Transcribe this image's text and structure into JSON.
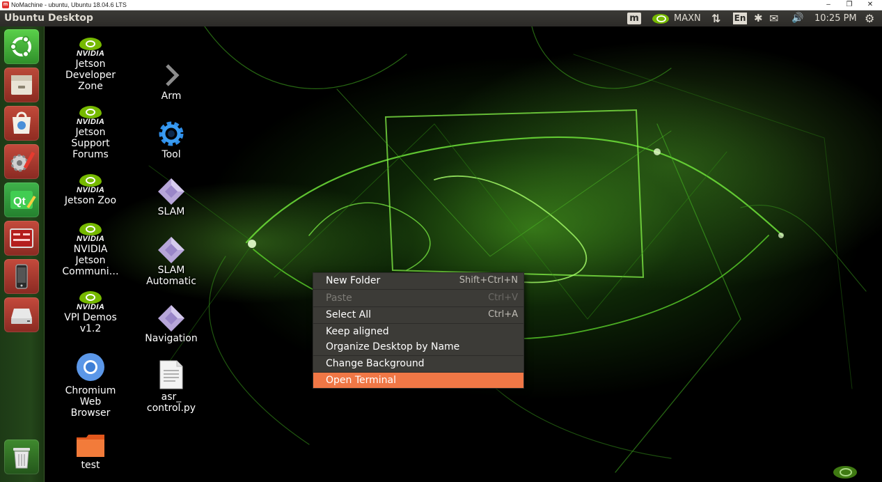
{
  "window": {
    "title": "NoMachine - ubuntu, Ubuntu 18.04.6 LTS",
    "logo": "m",
    "minimize": "–",
    "restore": "❐",
    "close": "✕"
  },
  "topbar": {
    "title": "Ubuntu Desktop",
    "nomachine_icon": "m",
    "power_mode": "MAXN",
    "keyboard_layout": "En",
    "network_glyph": "⇅",
    "bluetooth_glyph": "✱",
    "mail_glyph": "✉",
    "volume_glyph": "🔊",
    "clock": "10:25 PM",
    "settings_glyph": "⚙"
  },
  "launcher": {
    "items": [
      "ubuntu-home",
      "files",
      "software-center",
      "system-settings",
      "qt-creator",
      "terminal-app",
      "phone",
      "drive",
      "trash"
    ]
  },
  "desktop": {
    "nvidia_word": "NVIDIA",
    "icons": [
      {
        "label": "Jetson\nDeveloper\nZone",
        "icon": "nvidia-icon"
      },
      {
        "label": "Jetson\nSupport\nForums",
        "icon": "nvidia-icon"
      },
      {
        "label": "Jetson Zoo",
        "icon": "nvidia-icon"
      },
      {
        "label": "NVIDIA\nJetson\nCommuni…",
        "icon": "nvidia-icon"
      },
      {
        "label": "VPI Demos\nv1.2",
        "icon": "nvidia-icon"
      },
      {
        "label": "Chromium\nWeb\nBrowser",
        "icon": "chromium-icon"
      },
      {
        "label": "test",
        "icon": "folder-icon"
      },
      {
        "label": "Arm",
        "icon": "chevron-right-icon"
      },
      {
        "label": "Tool",
        "icon": "gear-icon"
      },
      {
        "label": "SLAM",
        "icon": "launcher-icon"
      },
      {
        "label": "SLAM\nAutomatic",
        "icon": "launcher-icon"
      },
      {
        "label": "Navigation",
        "icon": "launcher-icon"
      },
      {
        "label": "asr_\ncontrol.py",
        "icon": "text-file-icon"
      }
    ]
  },
  "context_menu": {
    "items": [
      {
        "label": "New Folder",
        "shortcut": "Shift+Ctrl+N",
        "state": "normal"
      },
      {
        "label": "Paste",
        "shortcut": "Ctrl+V",
        "state": "disabled"
      },
      {
        "label": "Select All",
        "shortcut": "Ctrl+A",
        "state": "normal"
      },
      {
        "label": "Keep aligned",
        "shortcut": "",
        "state": "normal"
      },
      {
        "label": "Organize Desktop by Name",
        "shortcut": "",
        "state": "normal"
      },
      {
        "label": "Change Background",
        "shortcut": "",
        "state": "normal"
      },
      {
        "label": "Open Terminal",
        "shortcut": "",
        "state": "highlighted"
      }
    ]
  },
  "colors": {
    "accent": "#f07746",
    "nvidia_green": "#76b900",
    "panel": "#2c2b28",
    "menu_bg": "#3c3b37"
  }
}
